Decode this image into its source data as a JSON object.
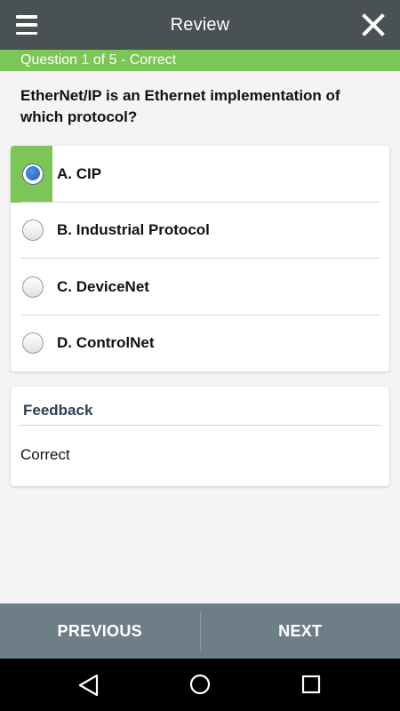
{
  "header": {
    "title": "Review",
    "menu_icon": "hamburger-menu-icon",
    "close_icon": "close-icon"
  },
  "status": {
    "text": "Question 1 of 5 - Correct",
    "color": "#7cc557"
  },
  "question": {
    "text": "EtherNet/IP is an Ethernet implementation of which protocol?"
  },
  "options": [
    {
      "label": "A. CIP",
      "selected": true
    },
    {
      "label": "B. Industrial Protocol",
      "selected": false
    },
    {
      "label": "C. DeviceNet",
      "selected": false
    },
    {
      "label": "D. ControlNet",
      "selected": false
    }
  ],
  "feedback": {
    "title": "Feedback",
    "text": "Correct"
  },
  "navigation": {
    "previous_label": "PREVIOUS",
    "next_label": "NEXT"
  },
  "system_nav": {
    "back_icon": "back-triangle-icon",
    "home_icon": "home-circle-icon",
    "recents_icon": "recents-square-icon"
  },
  "colors": {
    "appbar": "#4a5152",
    "accent_green": "#7cc557",
    "bottom_bar": "#6e7e86",
    "radio_selected": "#1f5fb3"
  }
}
